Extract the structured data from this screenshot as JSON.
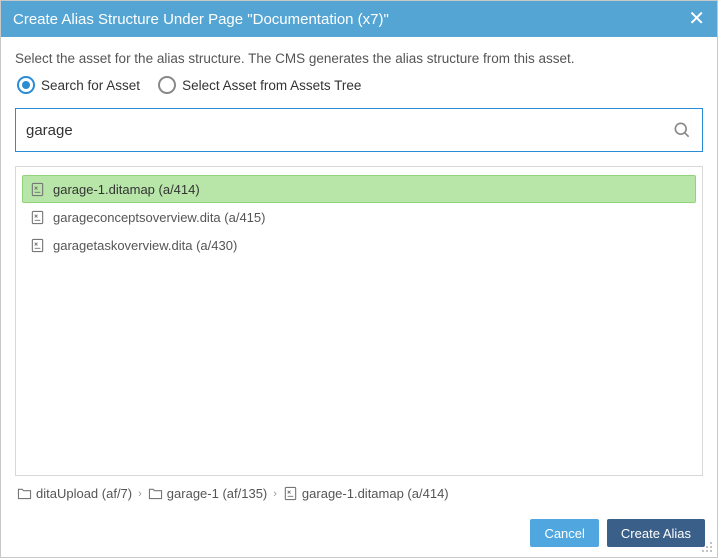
{
  "title": "Create Alias Structure Under Page \"Documentation (x7)\"",
  "instruction": "Select the asset for the alias structure. The CMS generates the alias structure from this asset.",
  "mode": {
    "search_label": "Search for Asset",
    "tree_label": "Select Asset from Assets Tree",
    "selected": "search"
  },
  "search": {
    "value": "garage",
    "placeholder": ""
  },
  "results": [
    {
      "label": "garage-1.ditamap (a/414)",
      "selected": true
    },
    {
      "label": "garageconceptsoverview.dita (a/415)",
      "selected": false
    },
    {
      "label": "garagetaskoverview.dita (a/430)",
      "selected": false
    }
  ],
  "breadcrumb": [
    {
      "icon": "folder",
      "label": "ditaUpload (af/7)"
    },
    {
      "icon": "folder",
      "label": "garage-1 (af/135)"
    },
    {
      "icon": "file",
      "label": "garage-1.ditamap (a/414)"
    }
  ],
  "buttons": {
    "cancel": "Cancel",
    "create": "Create Alias"
  }
}
